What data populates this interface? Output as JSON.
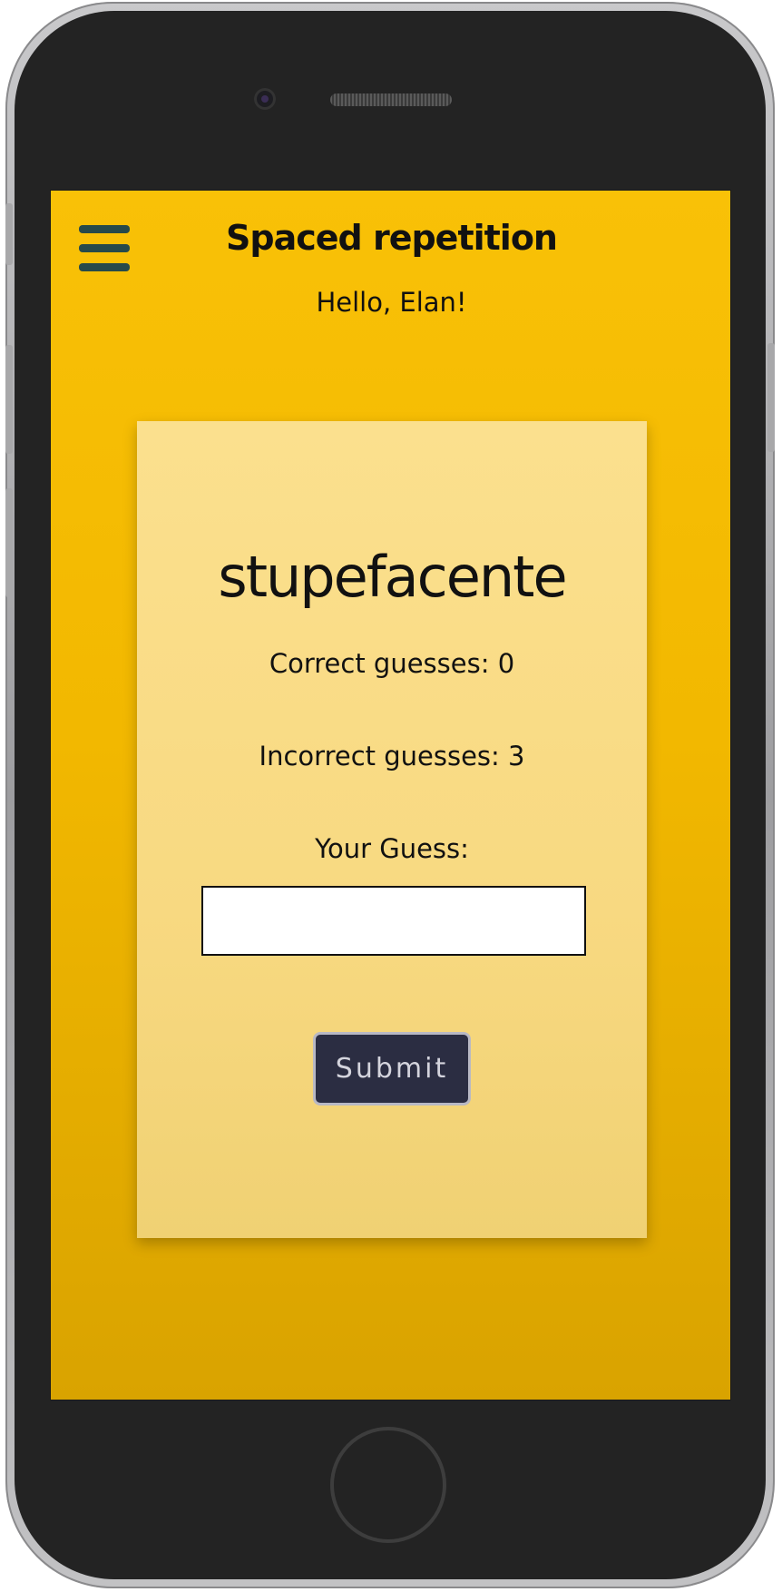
{
  "header": {
    "title": "Spaced repetition",
    "greeting": "Hello, Elan!",
    "menu_icon": "hamburger-menu-icon"
  },
  "card": {
    "word": "stupefacente",
    "correct_label": "Correct guesses: 0",
    "incorrect_label": "Incorrect guesses: 3",
    "guess_label": "Your Guess:",
    "guess_value": "",
    "submit_label": "Submit"
  },
  "colors": {
    "background": "#f2b800",
    "card": "#fbe08e",
    "menu_icon": "#274a4a",
    "button": "#2b2d42",
    "button_text": "#d4d4dd"
  }
}
